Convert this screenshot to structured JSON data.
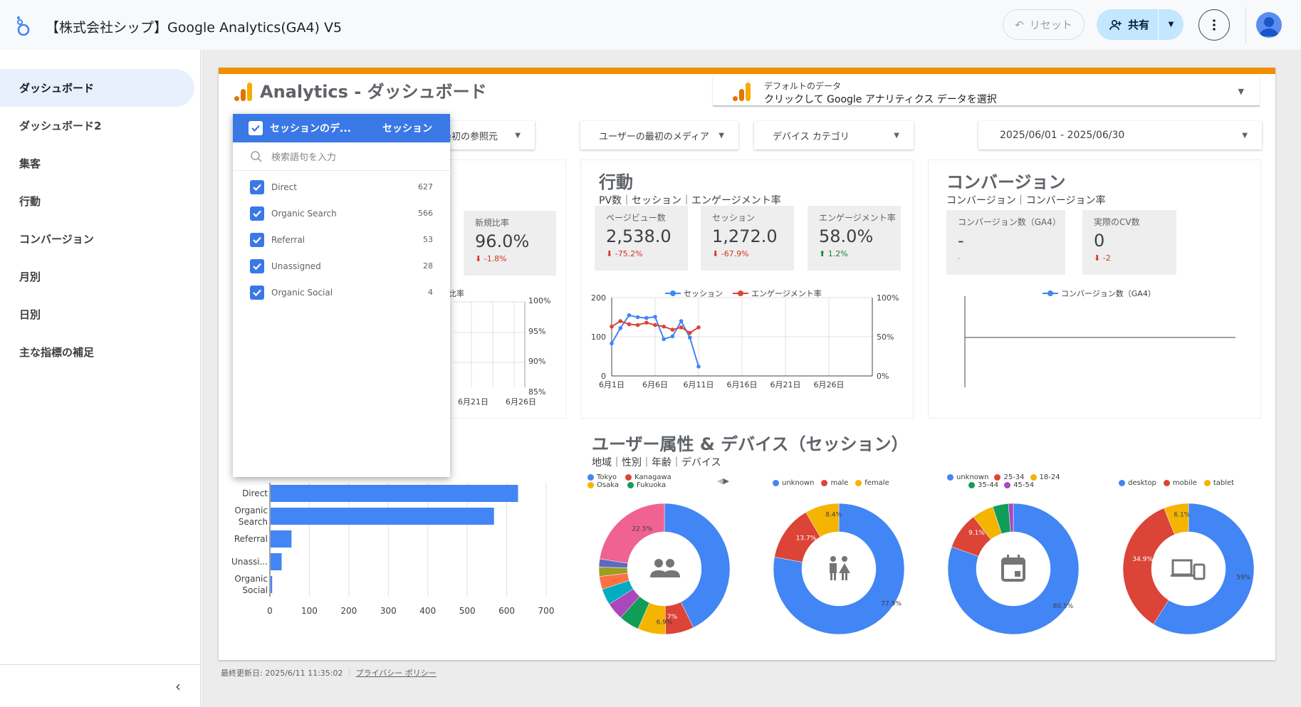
{
  "app": {
    "title": "【株式会社シップ】Google Analytics(GA4) V5",
    "reset_label": "リセット",
    "share_label": "共有"
  },
  "sidebar": {
    "items": [
      {
        "label": "ダッシュボード",
        "active": true
      },
      {
        "label": "ダッシュボード2",
        "active": false
      },
      {
        "label": "集客",
        "active": false
      },
      {
        "label": "行動",
        "active": false
      },
      {
        "label": "コンバージョン",
        "active": false
      },
      {
        "label": "月別",
        "active": false
      },
      {
        "label": "日別",
        "active": false
      },
      {
        "label": "主な指標の補足",
        "active": false
      }
    ],
    "collapse_icon": "chevron-left-icon"
  },
  "report": {
    "title": "Analytics - ダッシュボード",
    "datasource": {
      "label": "デフォルトのデータ",
      "value": "クリックして Google アナリティクス データを選択"
    },
    "filters": {
      "referrer": "ーの最初の参照元",
      "medium": "ユーザーの最初のメディア",
      "device": "デバイス カテゴリ",
      "daterange": "2025/06/01 - 2025/06/30"
    },
    "footer": {
      "updated": "最終更新日: 2025/6/11 11:35:02",
      "privacy": "プライバシー ポリシー"
    }
  },
  "dropdown": {
    "header_title": "セッションのデ...",
    "header_metric": "セッション",
    "search_placeholder": "検索語句を入力",
    "items": [
      {
        "label": "Direct",
        "count": "627"
      },
      {
        "label": "Organic Search",
        "count": "566"
      },
      {
        "label": "Referral",
        "count": "53"
      },
      {
        "label": "Unassigned",
        "count": "28"
      },
      {
        "label": "Organic Social",
        "count": "4"
      }
    ]
  },
  "acquisition": {
    "kpi_new_ratio": {
      "label": "新規比率",
      "value": "96.0%",
      "delta": "-1.8%"
    },
    "partial_legend": "比率",
    "right_axis": [
      "100%",
      "95%",
      "90%",
      "85%"
    ],
    "x_ticks": [
      "6月21日",
      "6月26日"
    ]
  },
  "behavior": {
    "title": "行動",
    "subtitle": "PV数｜セッション｜エンゲージメント率",
    "kpis": [
      {
        "label": "ページビュー数",
        "value": "2,538.0",
        "delta": "-75.2%",
        "dir": "neg"
      },
      {
        "label": "セッション",
        "value": "1,272.0",
        "delta": "-67.9%",
        "dir": "neg"
      },
      {
        "label": "エンゲージメント率",
        "value": "58.0%",
        "delta": "1.2%",
        "dir": "pos"
      }
    ],
    "legend": [
      "セッション",
      "エンゲージメント率"
    ],
    "left_axis": [
      "200",
      "100",
      "0"
    ],
    "right_axis": [
      "100%",
      "50%",
      "0%"
    ],
    "x_ticks": [
      "6月1日",
      "6月6日",
      "6月11日",
      "6月16日",
      "6月21日",
      "6月26日"
    ]
  },
  "conversion": {
    "title": "コンバージョン",
    "subtitle": "コンバージョン｜コンバージョン率",
    "kpis": [
      {
        "label": "コンバージョン数（GA4）",
        "value": "-",
        "delta": "-",
        "dir": "neu"
      },
      {
        "label": "実際のCV数",
        "value": "0",
        "delta": "-2",
        "dir": "neg"
      }
    ],
    "legend": "コンバージョン数（GA4）"
  },
  "demographics": {
    "title": "ユーザー属性 & デバイス（セッション）",
    "subtitle": "地域｜性別｜年齢｜デバイス",
    "region_legend": [
      "Tokyo",
      "Kanagawa",
      "Osaka",
      "Fukuoka"
    ],
    "gender_legend": [
      "unknown",
      "male",
      "female"
    ],
    "age_legend": [
      "unknown",
      "25-34",
      "18-24",
      "35-44",
      "45-54"
    ],
    "device_legend": [
      "desktop",
      "mobile",
      "tablet"
    ]
  },
  "colors": {
    "accent": "#f28e00",
    "blue": "#4285f4",
    "red": "#db4437",
    "yellow": "#f4b400",
    "green": "#0f9d58",
    "purple": "#ab47bc",
    "pink": "#f06292"
  },
  "chart_data": [
    {
      "type": "bar",
      "orientation": "horizontal",
      "categories": [
        "Direct",
        "Organic Search",
        "Referral",
        "Unassigned",
        "Organic Social"
      ],
      "category_labels": [
        "Direct",
        "Organic\nSearch",
        "Referral",
        "Unassi...",
        "Organic\nSocial"
      ],
      "values": [
        627,
        566,
        53,
        28,
        4
      ],
      "xlim": [
        0,
        700
      ],
      "x_ticks": [
        "0",
        "100",
        "200",
        "300",
        "400",
        "500",
        "600",
        "700"
      ]
    },
    {
      "type": "line",
      "x": [
        "6月1日",
        "6月2日",
        "6月3日",
        "6月4日",
        "6月5日",
        "6月6日",
        "6月7日",
        "6月8日",
        "6月9日",
        "6月10日",
        "6月11日"
      ],
      "series": [
        {
          "name": "セッション",
          "axis": "left",
          "values": [
            83,
            122,
            155,
            150,
            148,
            151,
            94,
            101,
            140,
            98,
            24
          ]
        },
        {
          "name": "エンゲージメント率",
          "axis": "right",
          "values": [
            0.63,
            0.7,
            0.66,
            0.65,
            0.68,
            0.65,
            0.63,
            0.59,
            0.62,
            0.55,
            0.62
          ]
        }
      ],
      "ylim_left": [
        0,
        200
      ],
      "ylim_right": [
        0,
        1
      ],
      "grid": true
    },
    {
      "type": "pie",
      "name": "region",
      "slices": [
        {
          "label": "Tokyo",
          "value": 42.6,
          "color": "#4285f4"
        },
        {
          "label": "Kanagawa",
          "value": 7.0,
          "color": "#db4437"
        },
        {
          "label": "Osaka",
          "value": 6.9,
          "color": "#f4b400"
        },
        {
          "label": "Fukuoka",
          "value": 5.0,
          "color": "#0f9d58"
        },
        {
          "label": "other1",
          "value": 4.3,
          "color": "#ab47bc"
        },
        {
          "label": "other2",
          "value": 4.0,
          "color": "#00acc1"
        },
        {
          "label": "other3",
          "value": 3.2,
          "color": "#ff7043"
        },
        {
          "label": "other4",
          "value": 2.3,
          "color": "#9e9d24"
        },
        {
          "label": "other5",
          "value": 2.0,
          "color": "#5c6bc0"
        },
        {
          "label": "other6",
          "value": 22.5,
          "color": "#f06292"
        }
      ],
      "labels_shown": [
        "42.6%",
        "7%",
        "6.9%",
        "22.5%"
      ]
    },
    {
      "type": "pie",
      "name": "gender",
      "slices": [
        {
          "label": "unknown",
          "value": 77.9,
          "color": "#4285f4"
        },
        {
          "label": "male",
          "value": 13.7,
          "color": "#db4437"
        },
        {
          "label": "female",
          "value": 8.4,
          "color": "#f4b400"
        }
      ],
      "labels_shown": [
        "77.9%",
        "13.7%",
        "8.4%"
      ]
    },
    {
      "type": "pie",
      "name": "age",
      "slices": [
        {
          "label": "unknown",
          "value": 80.5,
          "color": "#4285f4"
        },
        {
          "label": "25-34",
          "value": 9.1,
          "color": "#db4437"
        },
        {
          "label": "18-24",
          "value": 5.3,
          "color": "#f4b400"
        },
        {
          "label": "35-44",
          "value": 3.9,
          "color": "#0f9d58"
        },
        {
          "label": "45-54",
          "value": 1.2,
          "color": "#ab47bc"
        }
      ],
      "labels_shown": [
        "80.5%",
        "9.1%"
      ]
    },
    {
      "type": "pie",
      "name": "device",
      "slices": [
        {
          "label": "desktop",
          "value": 59,
          "color": "#4285f4"
        },
        {
          "label": "mobile",
          "value": 34.9,
          "color": "#db4437"
        },
        {
          "label": "tablet",
          "value": 6.1,
          "color": "#f4b400"
        }
      ],
      "labels_shown": [
        "59%",
        "34.9%",
        "6.1%"
      ]
    }
  ]
}
